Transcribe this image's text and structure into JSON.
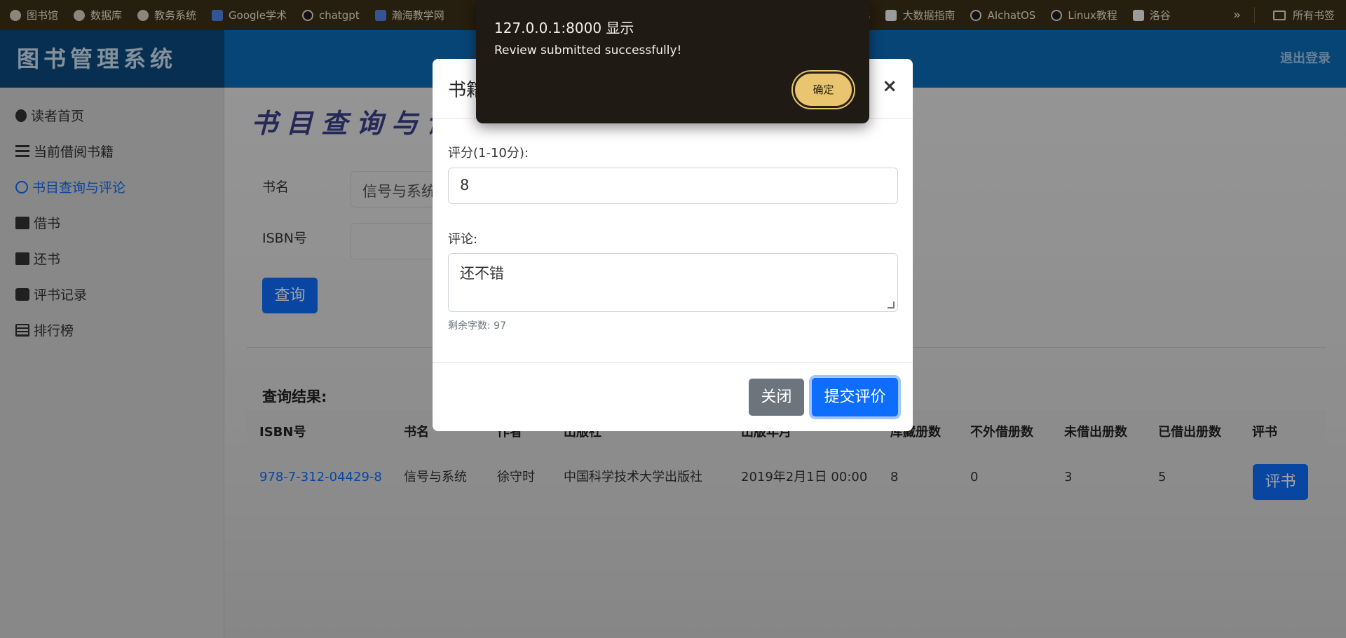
{
  "bookmarks": {
    "items": [
      {
        "label": "图书馆",
        "icon": "globe-icon"
      },
      {
        "label": "数据库",
        "icon": "globe-icon"
      },
      {
        "label": "教务系统",
        "icon": "globe-icon"
      },
      {
        "label": "Google学术",
        "icon": "scholar-icon"
      },
      {
        "label": "chatgpt",
        "icon": "openai-icon"
      },
      {
        "label": "瀚海教学网",
        "icon": "site-icon"
      },
      {
        "label": "eks",
        "icon": "site-icon"
      },
      {
        "label": "大数据指南",
        "icon": "site-icon"
      },
      {
        "label": "AIchatOS",
        "icon": "openai-icon"
      },
      {
        "label": "Linux教程",
        "icon": "linux-icon"
      },
      {
        "label": "洛谷",
        "icon": "site-icon"
      }
    ],
    "more_label": "»",
    "all_bookmarks_label": "所有书签"
  },
  "app": {
    "brand": "图书管理系统",
    "logout_label": "退出登录"
  },
  "sidebar": {
    "items": [
      {
        "label": "读者首页",
        "icon": "home-icon",
        "active": false
      },
      {
        "label": "当前借阅书籍",
        "icon": "list-icon",
        "active": false
      },
      {
        "label": "书目查询与评论",
        "icon": "search-icon",
        "active": true
      },
      {
        "label": "借书",
        "icon": "book-icon",
        "active": false
      },
      {
        "label": "还书",
        "icon": "book-icon",
        "active": false
      },
      {
        "label": "评书记录",
        "icon": "comment-icon",
        "active": false
      },
      {
        "label": "排行榜",
        "icon": "ranking-icon",
        "active": false
      }
    ]
  },
  "main": {
    "page_title": "书目查询与评",
    "form": {
      "title_label": "书名",
      "title_value": "信号与系统",
      "isbn_label": "ISBN号",
      "isbn_value": "",
      "query_button": "查询"
    },
    "results_label": "查询结果:",
    "table": {
      "headers": [
        "ISBN号",
        "书名",
        "作者",
        "出版社",
        "出版年月",
        "库藏册数",
        "不外借册数",
        "未借出册数",
        "已借出册数",
        "评书"
      ],
      "rows": [
        [
          "978-7-312-04429-8",
          "信号与系统",
          "徐守时",
          "中国科学技术大学出版社",
          "2019年2月1日 00:00",
          "8",
          "0",
          "3",
          "5"
        ]
      ],
      "rate_button": "评书"
    }
  },
  "modal": {
    "title": "书籍",
    "close_symbol": "×",
    "score_label": "评分(1-10分):",
    "score_value": "8",
    "comment_label": "评论:",
    "comment_value": "还不错",
    "remaining_hint": "剩余字数: 97",
    "close_button": "关闭",
    "submit_button": "提交评价"
  },
  "alert": {
    "title": "127.0.0.1:8000 显示",
    "message": "Review submitted successfully!",
    "ok_button": "确定"
  },
  "colors": {
    "accent": "#0d6efd",
    "bookmarks_bg": "#3c2f17",
    "topbar": "#0b6cb9",
    "brand_bg": "#0a4a7f",
    "alert_bg": "#1f1a14",
    "alert_button": "#e8c56e"
  }
}
